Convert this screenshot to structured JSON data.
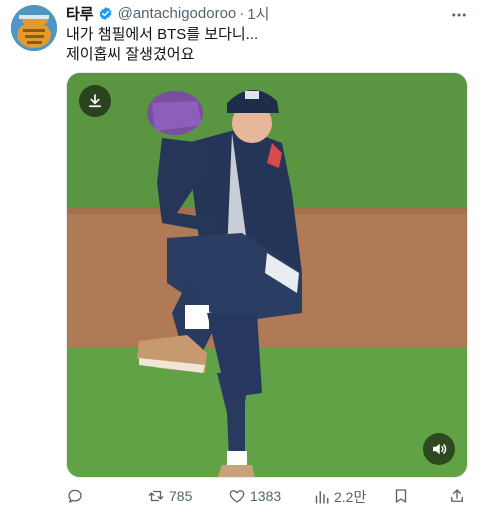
{
  "tweet": {
    "display_name": "타루",
    "handle": "@antachigodoroo",
    "separator": "·",
    "time": "1시",
    "text_line1": "내가 챔필에서 BTS를 보다니...",
    "text_line2": "제이홉씨 잘생겼어요",
    "more_icon": "more-icon",
    "verified_color": "#1d9bf0"
  },
  "media": {
    "download_icon": "download-icon",
    "sound_icon": "volume-icon"
  },
  "actions": {
    "reply_count": "",
    "retweet_count": "785",
    "like_count": "1383",
    "views_count": "2.2만"
  }
}
